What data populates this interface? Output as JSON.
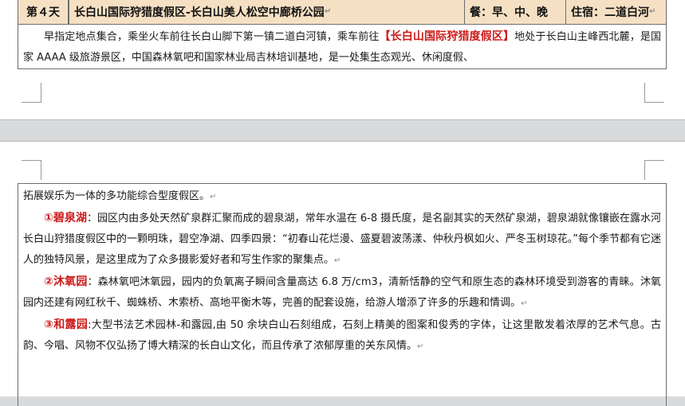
{
  "itinerary": {
    "day_label": "第４天",
    "route_title": "长白山国际狩猎度假区-长白山美人松空中廊桥公园",
    "meals": "餐：早、中、晚",
    "stay": "住宿：二道白河",
    "intro_before": "早指定地点集合，乘坐火车前往长白山脚下第一镇二道白河镇，乘车前往",
    "intro_highlight": "【长白山国际狩猎度假区】",
    "intro_after": "地处于长白山主峰西北麓，是国家 AAAA 级旅游景区，中国森林氧吧和国家林业局吉林培训基地，是一处集生态观光、休闲度假、",
    "continued": "拓展娱乐为一体的多功能综合型度假区。"
  },
  "attractions": [
    {
      "num": "①",
      "name": "碧泉湖",
      "text": "：园区内由多处天然矿泉群汇聚而成的碧泉湖，常年水温在 6-8 摄氏度，是名副其实的天然矿泉湖，碧泉湖就像镶嵌在露水河长白山狩猎度假区中的一颗明珠，碧空净湖、四季四景：“初春山花烂漫、盛夏碧波荡漾、仲秋丹枫如火、严冬玉树琼花。”每个季节都有它迷人的独特风景，是这里成为了众多摄影爱好者和写生作家的聚集点。"
    },
    {
      "num": "②",
      "name": "沐氧园",
      "text": "：森林氧吧沐氧园，园内的负氧离子瞬间含量高达 6.8 万/cm3，清新恬静的空气和原生态的森林环境受到游客的青睐。沐氧园内还建有网红秋千、蜘蛛桥、木索桥、高地平衡木等，完善的配套设施，给游人增添了许多的乐趣和情调。"
    },
    {
      "num": "③",
      "name": "和露园",
      "text": ":大型书法艺术园林-和露园,由 50 余块白山石刻组成，石刻上精美的图案和俊秀的字体，让这里散发着浓厚的艺术气息。古韵、今唱、风物不仅弘扬了博大精深的长白山文化，而且传承了浓郁厚重的关东风情。"
    }
  ],
  "paragraph_mark": "↵"
}
